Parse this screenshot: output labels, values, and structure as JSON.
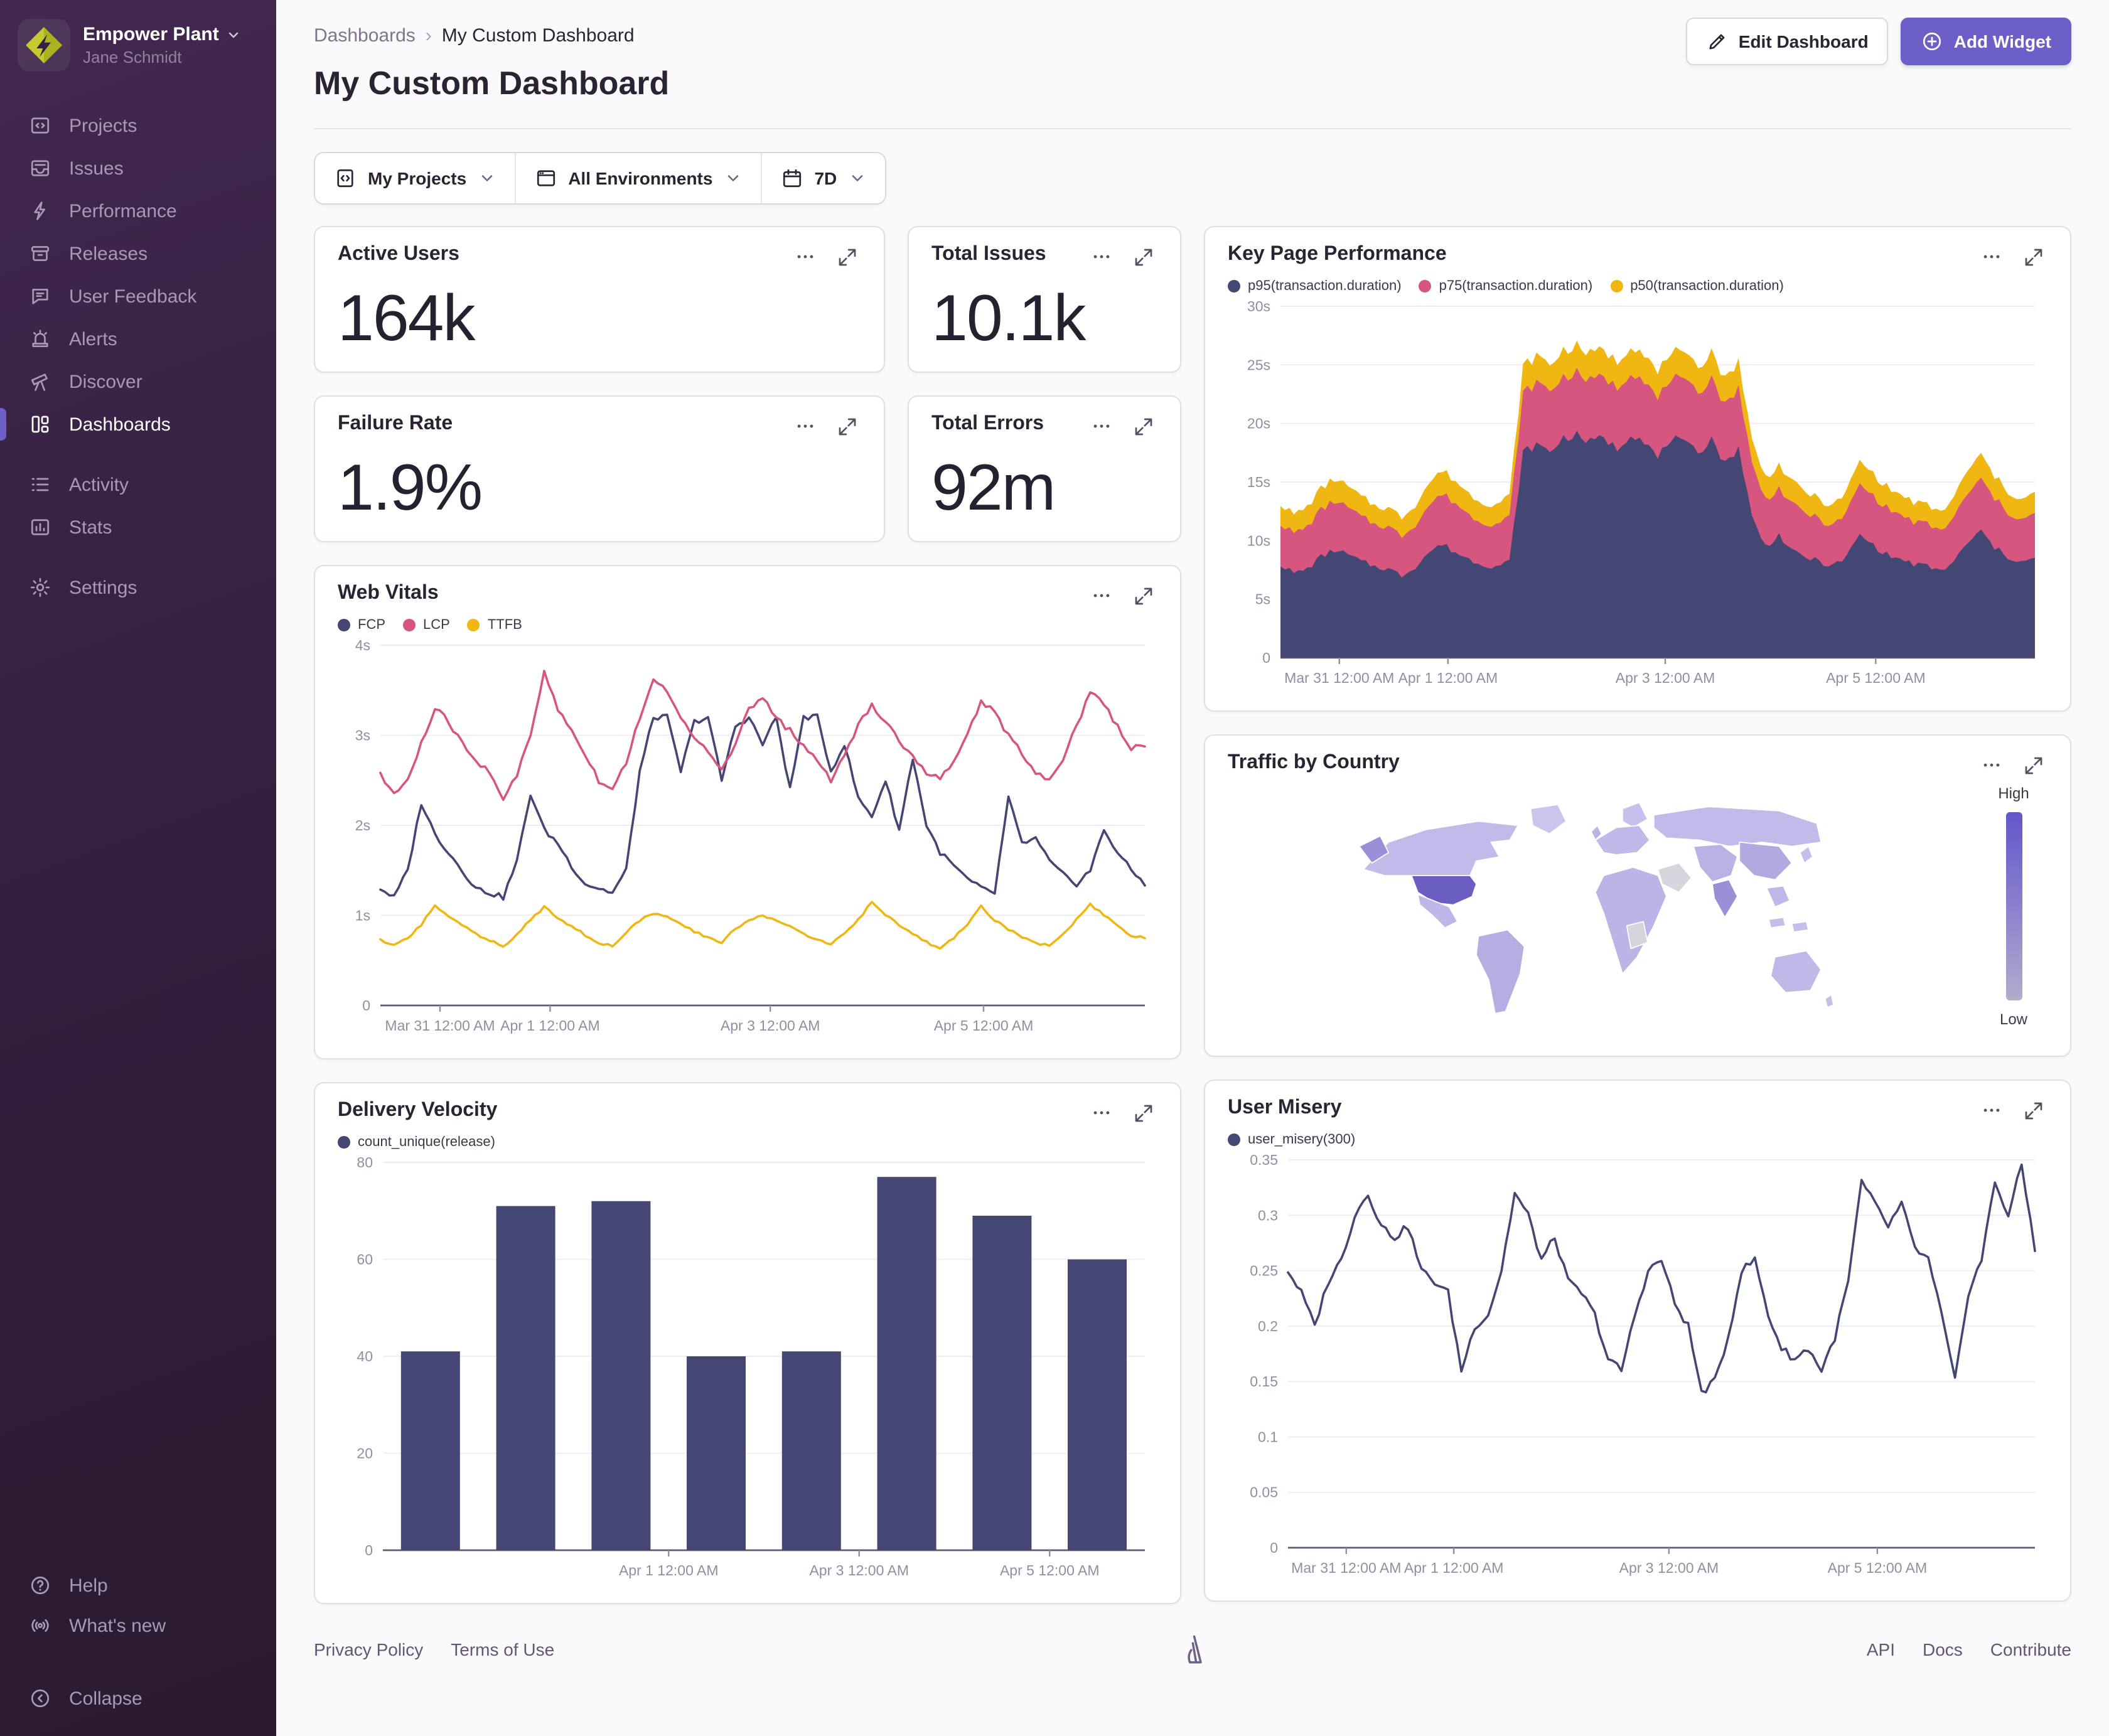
{
  "sidebar": {
    "org_name": "Empower Plant",
    "user_name": "Jane Schmidt",
    "groups": [
      {
        "items": [
          {
            "label": "Projects",
            "icon": "projects-icon"
          },
          {
            "label": "Issues",
            "icon": "issues-icon"
          },
          {
            "label": "Performance",
            "icon": "performance-icon"
          },
          {
            "label": "Releases",
            "icon": "releases-icon"
          },
          {
            "label": "User Feedback",
            "icon": "user-feedback-icon"
          },
          {
            "label": "Alerts",
            "icon": "alerts-icon"
          },
          {
            "label": "Discover",
            "icon": "discover-icon"
          },
          {
            "label": "Dashboards",
            "icon": "dashboards-icon",
            "active": true
          }
        ]
      },
      {
        "items": [
          {
            "label": "Activity",
            "icon": "activity-icon"
          },
          {
            "label": "Stats",
            "icon": "stats-icon"
          }
        ]
      },
      {
        "items": [
          {
            "label": "Settings",
            "icon": "settings-icon"
          }
        ]
      }
    ],
    "bottom_items": [
      {
        "label": "Help",
        "icon": "help-icon"
      },
      {
        "label": "What's new",
        "icon": "broadcast-icon"
      }
    ],
    "collapse_label": "Collapse"
  },
  "header": {
    "breadcrumbs": [
      "Dashboards",
      "My Custom Dashboard"
    ],
    "title": "My Custom Dashboard",
    "edit_button": "Edit Dashboard",
    "add_button": "Add Widget"
  },
  "filters": {
    "projects": "My Projects",
    "environments": "All Environments",
    "date_range": "7D"
  },
  "footer": {
    "privacy": "Privacy Policy",
    "terms": "Terms of Use",
    "api": "API",
    "docs": "Docs",
    "contribute": "Contribute"
  },
  "colors": {
    "accent": "#6C5FC7",
    "navy": "#444674",
    "pink": "#D6567F",
    "yellow": "#F0B712",
    "axis_text": "#948DA2",
    "grid": "#EFEDF3",
    "baseline": "#625A72",
    "map_high": "#6A5FC1",
    "map_mid": "#9A90D8",
    "map_low": "#C3BAE9",
    "map_none": "#D8D4DD"
  },
  "widgets": {
    "active_users": {
      "title": "Active Users",
      "value": "164k"
    },
    "total_issues": {
      "title": "Total Issues",
      "value": "10.1k"
    },
    "failure_rate": {
      "title": "Failure Rate",
      "value": "1.9%"
    },
    "total_errors": {
      "title": "Total Errors",
      "value": "92m"
    },
    "key_page_performance": {
      "title": "Key Page Performance"
    },
    "web_vitals": {
      "title": "Web Vitals"
    },
    "traffic_by_country": {
      "title": "Traffic by Country",
      "legend_high": "High",
      "legend_low": "Low"
    },
    "delivery_velocity": {
      "title": "Delivery Velocity"
    },
    "user_misery": {
      "title": "User Misery"
    }
  },
  "chart_data": {
    "key_page_performance": {
      "type": "area",
      "ylim": [
        0,
        30
      ],
      "unit": "seconds",
      "yticks": [
        {
          "v": 0,
          "l": "0"
        },
        {
          "v": 5,
          "l": "5s"
        },
        {
          "v": 10,
          "l": "10s"
        },
        {
          "v": 15,
          "l": "15s"
        },
        {
          "v": 20,
          "l": "20s"
        },
        {
          "v": 25,
          "l": "25s"
        },
        {
          "v": 30,
          "l": "30s"
        }
      ],
      "xlabels": [
        {
          "f": 0.078,
          "l": "Mar 31 12:00 AM"
        },
        {
          "f": 0.222,
          "l": "Apr 1 12:00 AM"
        },
        {
          "f": 0.51,
          "l": "Apr 3 12:00 AM"
        },
        {
          "f": 0.789,
          "l": "Apr 5 12:00 AM"
        }
      ],
      "jitter": 0.32,
      "series": [
        {
          "name": "p95(transaction.duration)",
          "color_key": "navy",
          "values": [
            8.0,
            7.2,
            7.6,
            8.6,
            9.2,
            8.8,
            8.2,
            7.8,
            7.6,
            7.0,
            7.8,
            9.0,
            9.7,
            9.0,
            8.4,
            8.0,
            7.8,
            8.2,
            17.5,
            18.2,
            17.6,
            18.8,
            19.0,
            18.4,
            18.8,
            17.8,
            19.2,
            18.6,
            17.0,
            18.8,
            18.2,
            17.5,
            18.8,
            16.5,
            18.0,
            12.0,
            9.5,
            10.5,
            9.0,
            8.6,
            8.2,
            7.8,
            8.6,
            10.5,
            9.6,
            8.8,
            8.4,
            8.0,
            7.8,
            7.4,
            8.2,
            9.8,
            10.8,
            9.4,
            8.6,
            8.2,
            8.4
          ]
        },
        {
          "name": "p75(transaction.duration)",
          "color_key": "pink",
          "values": [
            11.5,
            10.6,
            11.2,
            12.6,
            13.4,
            12.8,
            12.0,
            11.4,
            11.2,
            10.4,
            11.4,
            13.0,
            14.0,
            13.2,
            12.2,
            11.6,
            11.4,
            12.0,
            22.5,
            23.5,
            22.8,
            24.0,
            24.3,
            23.6,
            24.0,
            23.0,
            24.5,
            23.8,
            22.0,
            24.0,
            23.4,
            22.6,
            24.0,
            21.5,
            23.2,
            16.5,
            13.5,
            14.5,
            13.0,
            12.4,
            11.8,
            11.2,
            12.4,
            14.8,
            13.8,
            12.8,
            12.2,
            11.6,
            11.4,
            10.8,
            12.0,
            14.0,
            15.2,
            13.6,
            12.4,
            11.8,
            12.2
          ]
        },
        {
          "name": "p50(transaction.duration)",
          "color_key": "yellow",
          "values": [
            13.2,
            12.2,
            12.9,
            14.4,
            15.3,
            14.6,
            13.7,
            13.0,
            12.8,
            12.0,
            13.1,
            14.9,
            16.0,
            15.1,
            14.0,
            13.3,
            13.1,
            13.8,
            24.8,
            25.8,
            25.0,
            26.3,
            26.6,
            25.9,
            26.3,
            25.2,
            26.8,
            26.1,
            24.2,
            26.3,
            25.6,
            24.8,
            26.3,
            23.7,
            25.5,
            18.5,
            15.4,
            16.5,
            14.9,
            14.2,
            13.5,
            12.9,
            14.2,
            16.8,
            15.7,
            14.6,
            13.9,
            13.3,
            13.0,
            12.4,
            13.7,
            16.0,
            17.3,
            15.5,
            14.2,
            13.5,
            14.0
          ]
        }
      ]
    },
    "web_vitals": {
      "type": "line",
      "ylim": [
        0,
        4
      ],
      "unit": "seconds",
      "yticks": [
        {
          "v": 0,
          "l": "0"
        },
        {
          "v": 1,
          "l": "1s"
        },
        {
          "v": 2,
          "l": "2s"
        },
        {
          "v": 3,
          "l": "3s"
        },
        {
          "v": 4,
          "l": "4s"
        }
      ],
      "xlabels": [
        {
          "f": 0.078,
          "l": "Mar 31 12:00 AM"
        },
        {
          "f": 0.222,
          "l": "Apr 1 12:00 AM"
        },
        {
          "f": 0.51,
          "l": "Apr 3 12:00 AM"
        },
        {
          "f": 0.789,
          "l": "Apr 5 12:00 AM"
        }
      ],
      "series": [
        {
          "name": "FCP",
          "color_key": "navy",
          "jitter": 0.06,
          "values": [
            1.3,
            1.2,
            1.5,
            2.25,
            1.9,
            1.7,
            1.5,
            1.3,
            1.25,
            1.2,
            1.6,
            2.35,
            1.95,
            1.8,
            1.55,
            1.35,
            1.3,
            1.25,
            1.5,
            2.6,
            3.2,
            3.2,
            2.6,
            3.15,
            3.2,
            2.5,
            3.1,
            3.2,
            2.9,
            3.2,
            2.4,
            3.2,
            3.2,
            2.6,
            2.9,
            2.3,
            2.1,
            2.5,
            1.95,
            2.75,
            2.0,
            1.7,
            1.55,
            1.4,
            1.3,
            1.25,
            2.3,
            1.8,
            1.85,
            1.6,
            1.45,
            1.35,
            1.5,
            1.95,
            1.7,
            1.5,
            1.35
          ]
        },
        {
          "name": "LCP",
          "color_key": "pink",
          "jitter": 0.07,
          "values": [
            2.55,
            2.35,
            2.5,
            2.9,
            3.3,
            3.15,
            2.9,
            2.7,
            2.6,
            2.3,
            2.55,
            3.0,
            3.7,
            3.3,
            3.05,
            2.8,
            2.5,
            2.4,
            2.7,
            3.2,
            3.65,
            3.45,
            3.2,
            3.0,
            2.8,
            2.6,
            2.9,
            3.3,
            3.4,
            3.2,
            3.05,
            2.9,
            2.7,
            2.5,
            2.8,
            3.1,
            3.35,
            3.15,
            2.95,
            2.75,
            2.6,
            2.5,
            2.7,
            3.0,
            3.4,
            3.25,
            3.0,
            2.8,
            2.6,
            2.5,
            2.75,
            3.1,
            3.5,
            3.35,
            3.1,
            2.85,
            2.9
          ]
        },
        {
          "name": "TTFB",
          "color_key": "yellow",
          "jitter": 0.03,
          "values": [
            0.72,
            0.66,
            0.75,
            0.9,
            1.1,
            1.0,
            0.9,
            0.8,
            0.72,
            0.65,
            0.78,
            0.95,
            1.1,
            0.98,
            0.88,
            0.78,
            0.7,
            0.66,
            0.8,
            0.95,
            1.02,
            0.98,
            0.9,
            0.82,
            0.75,
            0.7,
            0.85,
            0.95,
            1.0,
            0.95,
            0.88,
            0.8,
            0.72,
            0.68,
            0.8,
            0.95,
            1.15,
            1.0,
            0.9,
            0.8,
            0.7,
            0.64,
            0.75,
            0.9,
            1.1,
            0.95,
            0.85,
            0.75,
            0.7,
            0.66,
            0.78,
            0.95,
            1.12,
            1.0,
            0.88,
            0.78,
            0.74
          ]
        }
      ]
    },
    "delivery_velocity": {
      "type": "bar",
      "ylim": [
        0,
        80
      ],
      "yticks": [
        {
          "v": 0,
          "l": "0"
        },
        {
          "v": 20,
          "l": "20"
        },
        {
          "v": 40,
          "l": "40"
        },
        {
          "v": 60,
          "l": "60"
        },
        {
          "v": 80,
          "l": "80"
        }
      ],
      "xlabels": [
        {
          "idx": 3,
          "l": "Apr 1 12:00 AM"
        },
        {
          "idx": 5,
          "l": "Apr 3 12:00 AM"
        },
        {
          "idx": 7,
          "l": "Apr 5 12:00 AM"
        }
      ],
      "series": [
        {
          "name": "count_unique(release)",
          "color_key": "navy",
          "values": [
            41,
            71,
            72,
            40,
            41,
            77,
            69,
            60
          ]
        }
      ]
    },
    "user_misery": {
      "type": "line",
      "ylim": [
        0,
        0.35
      ],
      "yticks": [
        {
          "v": 0,
          "l": "0"
        },
        {
          "v": 0.05,
          "l": "0.05"
        },
        {
          "v": 0.1,
          "l": "0.1"
        },
        {
          "v": 0.15,
          "l": "0.15"
        },
        {
          "v": 0.2,
          "l": "0.2"
        },
        {
          "v": 0.25,
          "l": "0.25"
        },
        {
          "v": 0.3,
          "l": "0.3"
        },
        {
          "v": 0.35,
          "l": "0.35"
        }
      ],
      "xlabels": [
        {
          "f": 0.078,
          "l": "Mar 31 12:00 AM"
        },
        {
          "f": 0.222,
          "l": "Apr 1 12:00 AM"
        },
        {
          "f": 0.51,
          "l": "Apr 3 12:00 AM"
        },
        {
          "f": 0.789,
          "l": "Apr 5 12:00 AM"
        }
      ],
      "series": [
        {
          "name": "user_misery(300)",
          "color_key": "navy",
          "jitter": 0.007,
          "values": [
            0.25,
            0.23,
            0.2,
            0.24,
            0.26,
            0.3,
            0.32,
            0.29,
            0.28,
            0.29,
            0.25,
            0.24,
            0.23,
            0.16,
            0.2,
            0.21,
            0.25,
            0.32,
            0.3,
            0.26,
            0.28,
            0.24,
            0.23,
            0.21,
            0.17,
            0.16,
            0.21,
            0.25,
            0.26,
            0.22,
            0.2,
            0.14,
            0.15,
            0.19,
            0.25,
            0.26,
            0.21,
            0.18,
            0.17,
            0.18,
            0.16,
            0.19,
            0.24,
            0.33,
            0.31,
            0.29,
            0.31,
            0.27,
            0.26,
            0.21,
            0.15,
            0.23,
            0.26,
            0.33,
            0.3,
            0.345,
            0.27
          ]
        }
      ]
    },
    "traffic_by_country": {
      "type": "choropleth_map",
      "scale_labels": [
        "High",
        "Low"
      ],
      "highest_country": "United States"
    }
  }
}
